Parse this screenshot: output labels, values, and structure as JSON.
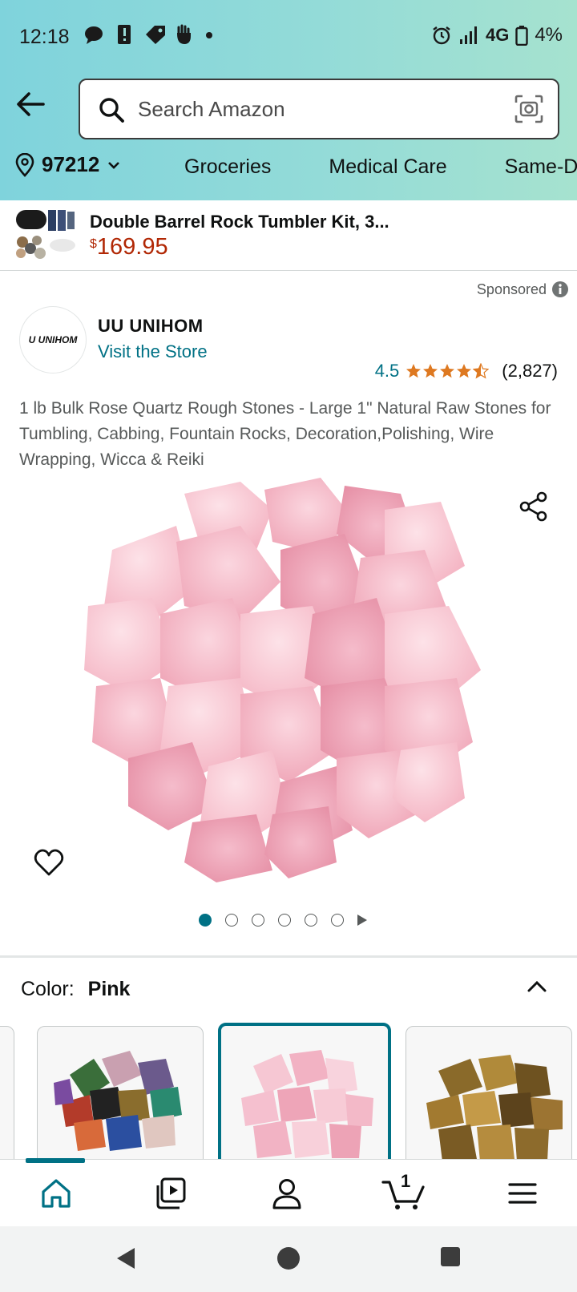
{
  "status_bar": {
    "time": "12:18",
    "network": "4G",
    "battery": "4%"
  },
  "search": {
    "placeholder": "Search Amazon"
  },
  "location": {
    "zip": "97212"
  },
  "nav_links": [
    "Groceries",
    "Medical Care",
    "Same-D"
  ],
  "ad": {
    "title": "Double Barrel Rock Tumbler Kit, 3...",
    "currency": "$",
    "price": "169.95"
  },
  "sponsored_label": "Sponsored",
  "brand": {
    "logo_text": "U UNIHOM",
    "name": "UU UNIHOM",
    "store_link": "Visit the Store"
  },
  "rating": {
    "value": "4.5",
    "count": "(2,827)"
  },
  "product": {
    "title": "1 lb Bulk Rose Quartz Rough Stones - Large 1\" Natural Raw Stones for Tumbling, Cabbing, Fountain Rocks, Decoration,Polishing, Wire Wrapping, Wicca & Reiki"
  },
  "gallery": {
    "image_count": 6,
    "active_index": 0
  },
  "color": {
    "label": "Color:",
    "value": "Pink"
  },
  "cart": {
    "count": "1"
  },
  "colors": {
    "accent": "#007185",
    "price": "#b12704",
    "star": "#de7921"
  }
}
